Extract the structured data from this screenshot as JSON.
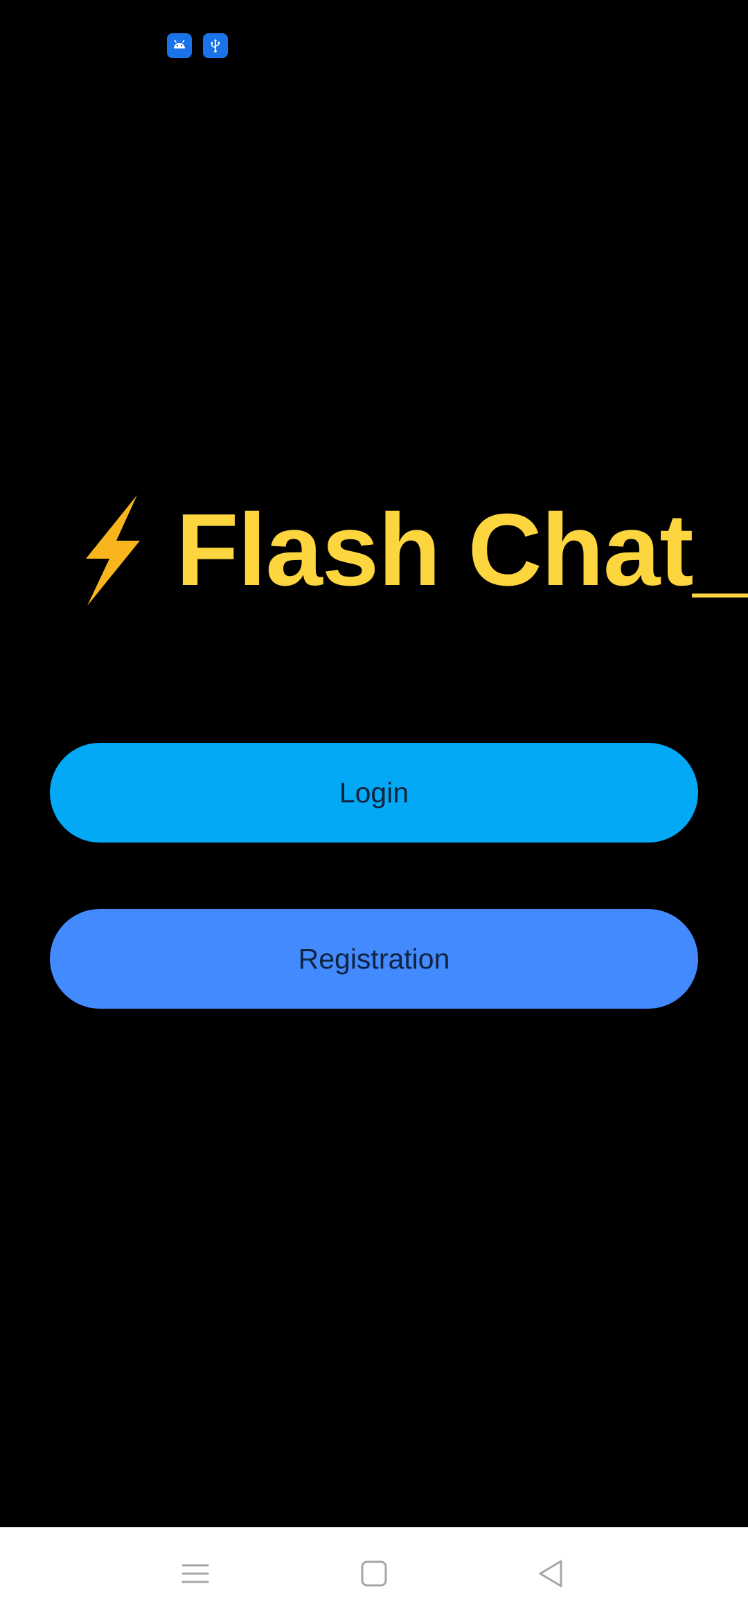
{
  "app": {
    "title": "Flash Chat_",
    "title_color": "#fcd53f",
    "logo_icon": "lightning-bolt-icon",
    "logo_color": "#f9b51d"
  },
  "status_bar": {
    "notification_icons": [
      "android-icon",
      "usb-icon"
    ],
    "icon_bg_color": "#1a73e8"
  },
  "buttons": {
    "login_label": "Login",
    "login_color": "#03a9f4",
    "register_label": "Registration",
    "register_color": "#448aff"
  },
  "nav_bar": {
    "items": [
      "menu-icon",
      "home-icon",
      "back-icon"
    ]
  }
}
